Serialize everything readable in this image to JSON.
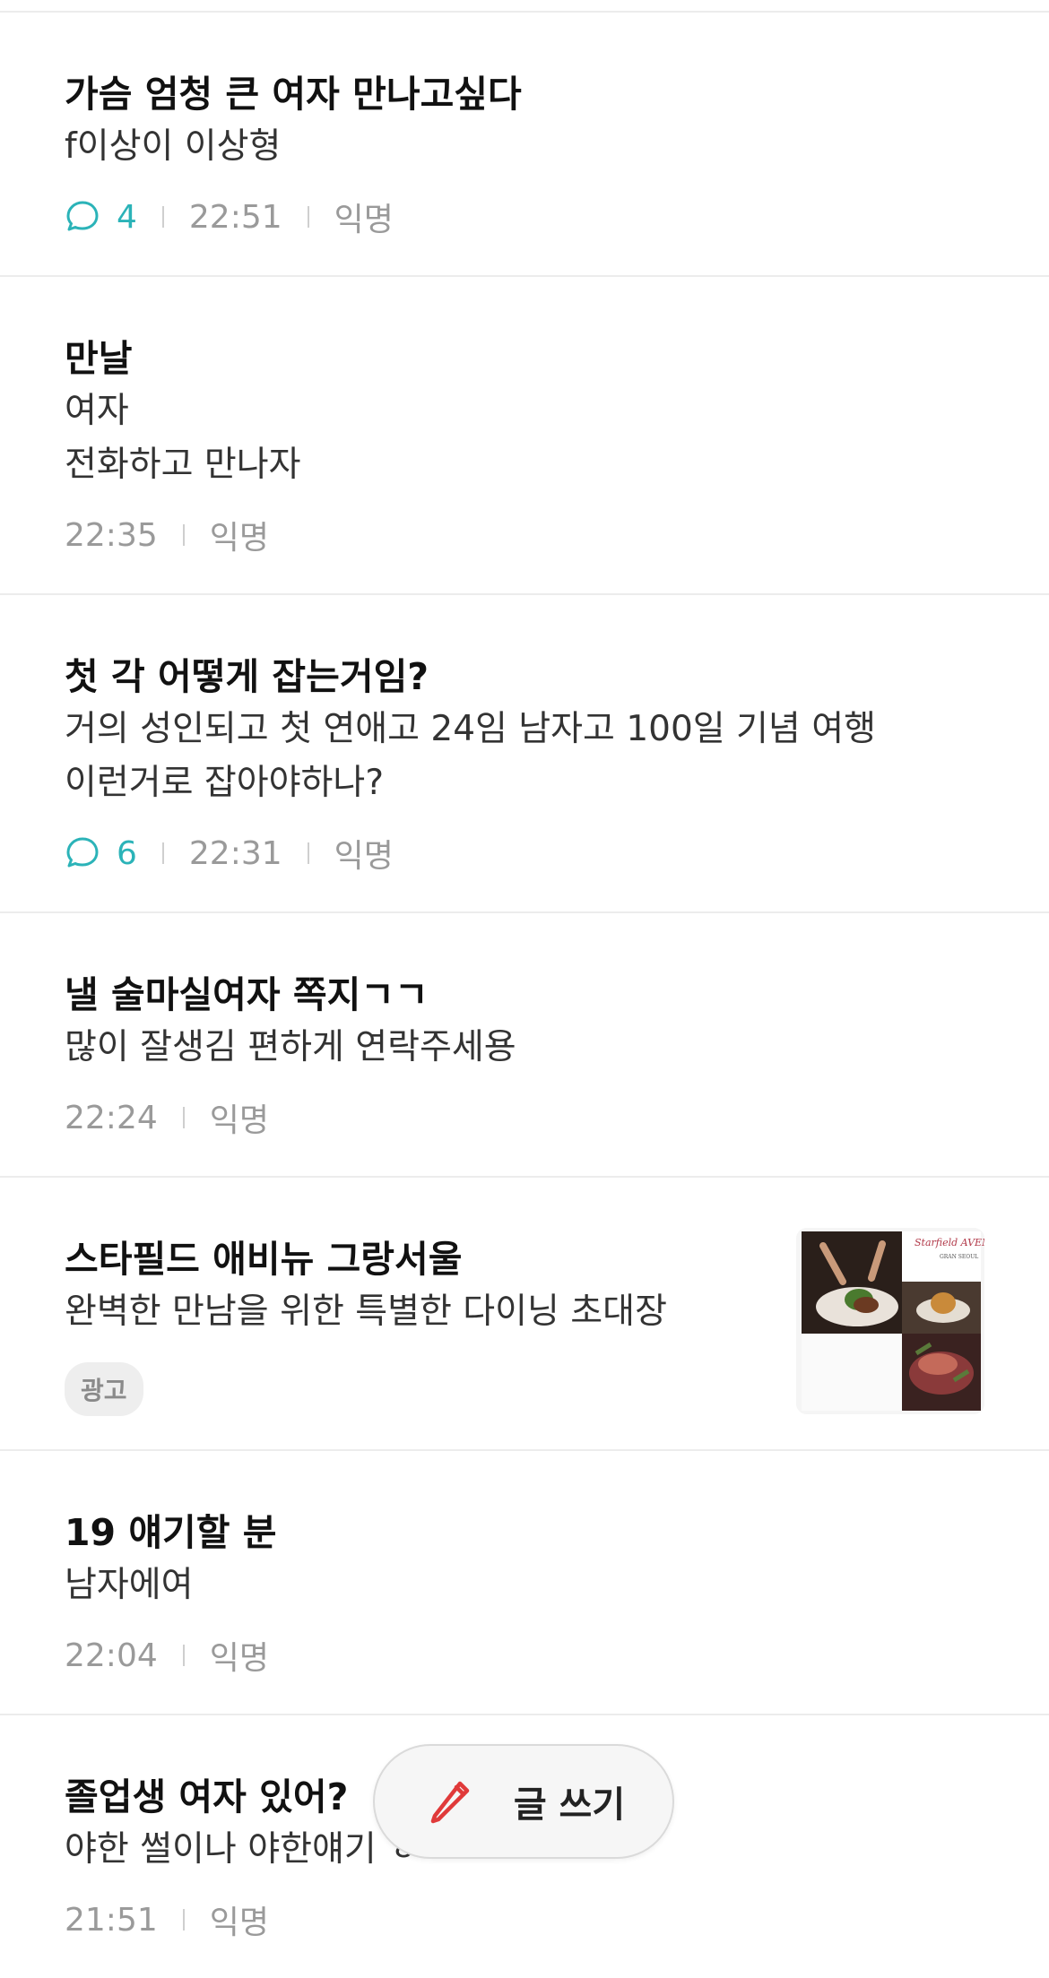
{
  "posts": [
    {
      "title": "가슴 엄청 큰 여자 만나고싶다",
      "lines": [
        "f이상이 이상형"
      ],
      "comments": "4",
      "time": "22:51",
      "author": "익명"
    },
    {
      "title": "만날",
      "lines": [
        "여자",
        "전화하고 만나자"
      ],
      "time": "22:35",
      "author": "익명"
    },
    {
      "title": "첫 각 어떻게 잡는거임?",
      "lines": [
        "거의 성인되고 첫 연애고 24임 남자고 100일 기념 여행",
        "이런거로 잡아야하나?"
      ],
      "comments": "6",
      "time": "22:31",
      "author": "익명"
    },
    {
      "title": "낼 술마실여자 쪽지ㄱㄱ",
      "lines": [
        "많이 잘생김 편하게 연락주세용"
      ],
      "time": "22:24",
      "author": "익명"
    },
    {
      "title": "19 얘기할 분",
      "lines": [
        "남자에여"
      ],
      "time": "22:04",
      "author": "익명"
    },
    {
      "title": "졸업생 여자 있어?",
      "lines": [
        "야한 썰이나 야한얘기 ㅎㅎ"
      ],
      "time": "21:51",
      "author": "익명"
    }
  ],
  "ad": {
    "title": "스타필드 애비뉴 그랑서울",
    "body": "완벽한 만남을 위한 특별한 다이닝 초대장",
    "badge": "광고",
    "thumb_brand": "Starfield AVENUE",
    "thumb_sub": "GRAN SEOUL"
  },
  "fab": {
    "label": "글 쓰기",
    "icon": "pencil-icon"
  },
  "colors": {
    "accent_comment": "#2bb3b8",
    "pencil": "#e03a3a"
  }
}
